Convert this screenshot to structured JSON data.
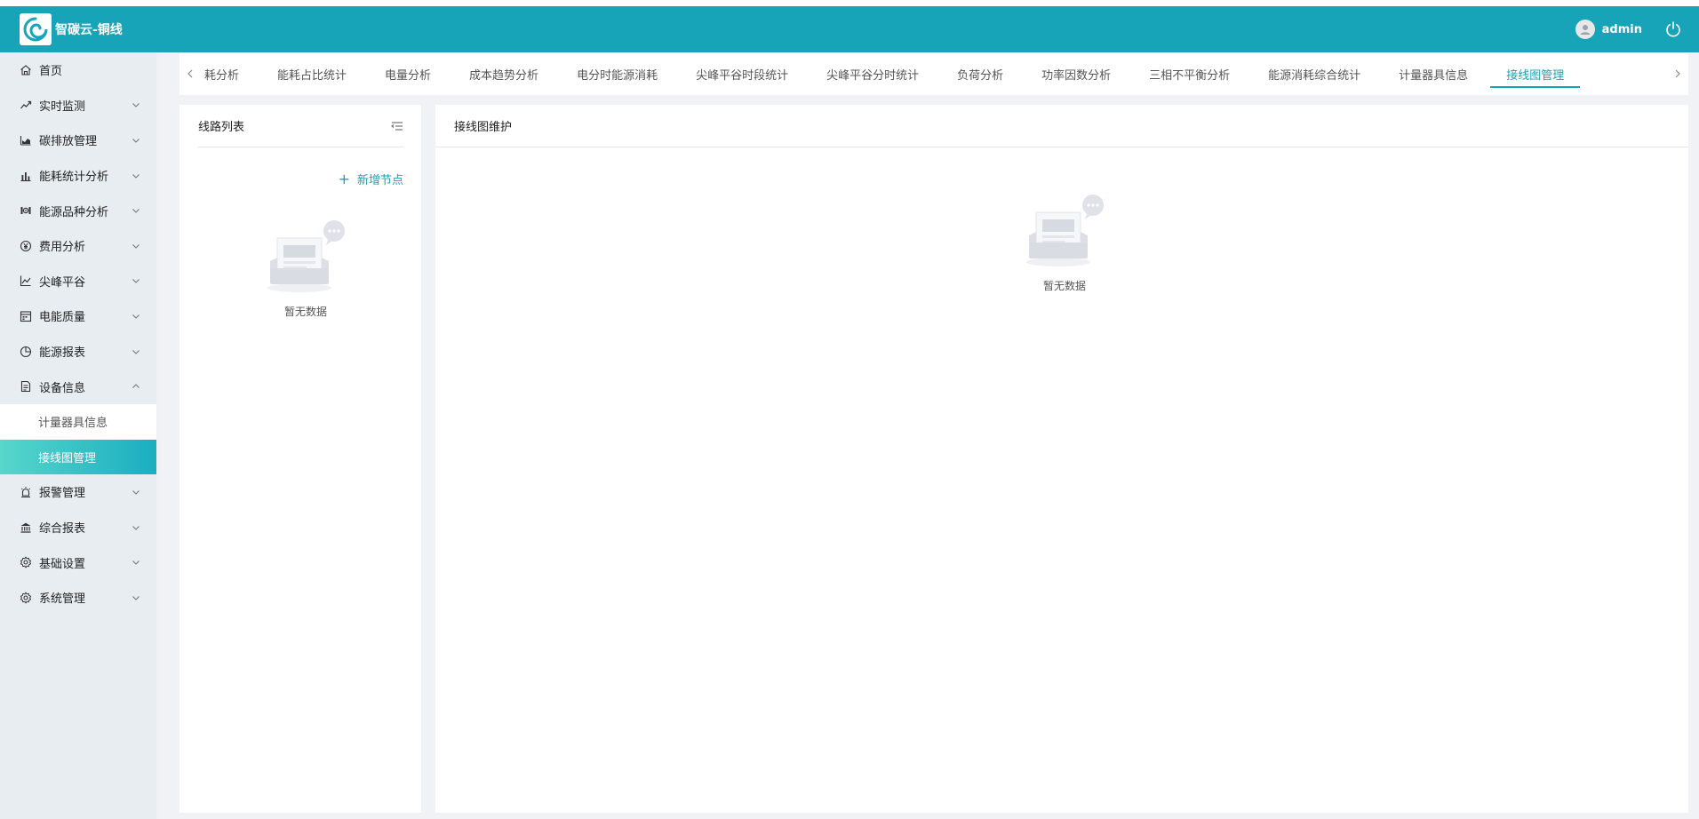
{
  "header": {
    "title": "智碳云-铜线",
    "username": "admin"
  },
  "sidebar": {
    "items": [
      {
        "label": "首页",
        "icon": "home-icon",
        "chevron": "none"
      },
      {
        "label": "实时监测",
        "icon": "trend-line-icon",
        "chevron": "down"
      },
      {
        "label": "碳排放管理",
        "icon": "area-chart-icon",
        "chevron": "down"
      },
      {
        "label": "能耗统计分析",
        "icon": "bar-chart-icon",
        "chevron": "down"
      },
      {
        "label": "能源品种分析",
        "icon": "energy-icon",
        "chevron": "down"
      },
      {
        "label": "费用分析",
        "icon": "yen-icon",
        "chevron": "down"
      },
      {
        "label": "尖峰平谷",
        "icon": "line-chart-icon",
        "chevron": "down"
      },
      {
        "label": "电能质量",
        "icon": "calendar-icon",
        "chevron": "down"
      },
      {
        "label": "能源报表",
        "icon": "pie-chart-icon",
        "chevron": "down"
      },
      {
        "label": "设备信息",
        "icon": "document-icon",
        "chevron": "up"
      }
    ],
    "sub_items": [
      {
        "label": "计量器具信息",
        "state": "light"
      },
      {
        "label": "接线图管理",
        "state": "active"
      }
    ],
    "items_after": [
      {
        "label": "报警管理",
        "icon": "alarm-icon",
        "chevron": "down"
      },
      {
        "label": "综合报表",
        "icon": "bank-icon",
        "chevron": "down"
      },
      {
        "label": "基础设置",
        "icon": "settings-icon",
        "chevron": "down"
      },
      {
        "label": "系统管理",
        "icon": "system-settings-icon",
        "chevron": "down"
      }
    ]
  },
  "tabs": [
    {
      "label": "耗分析"
    },
    {
      "label": "能耗占比统计"
    },
    {
      "label": "电量分析"
    },
    {
      "label": "成本趋势分析"
    },
    {
      "label": "电分时能源消耗"
    },
    {
      "label": "尖峰平谷时段统计"
    },
    {
      "label": "尖峰平谷分时统计"
    },
    {
      "label": "负荷分析"
    },
    {
      "label": "功率因数分析"
    },
    {
      "label": "三相不平衡分析"
    },
    {
      "label": "能源消耗综合统计"
    },
    {
      "label": "计量器具信息"
    },
    {
      "label": "接线图管理",
      "active": true
    }
  ],
  "left_panel": {
    "title": "线路列表",
    "add_node_label": "新增节点",
    "empty_text": "暂无数据"
  },
  "right_panel": {
    "title": "接线图维护",
    "empty_text": "暂无数据"
  },
  "colors": {
    "primary": "#17a4b8",
    "active_gradient_start": "#57d6cc",
    "active_gradient_end": "#1aaec0",
    "sidebar_bg": "#e7edf1"
  }
}
